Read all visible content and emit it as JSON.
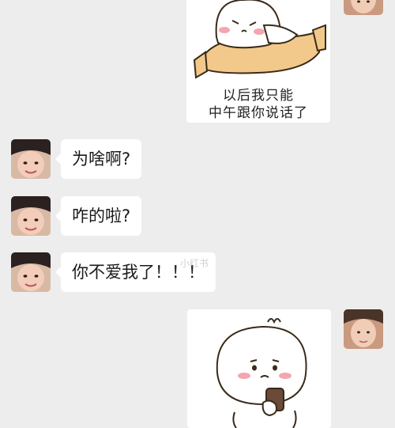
{
  "chat": {
    "messages": [
      {
        "sender": "me",
        "type": "sticker",
        "caption_line1": "以后我只能",
        "caption_line2": "中午跟你说话了"
      },
      {
        "sender": "other",
        "type": "text",
        "text": "为啥啊?"
      },
      {
        "sender": "other",
        "type": "text",
        "text": "咋的啦?"
      },
      {
        "sender": "other",
        "type": "text",
        "text": "你不爱我了！！！"
      },
      {
        "sender": "me",
        "type": "sticker",
        "caption_line1": "",
        "caption_line2": ""
      }
    ],
    "watermark": "小红书"
  },
  "colors": {
    "background": "#ededed",
    "bubble": "#ffffff",
    "text": "#1a1a1a"
  }
}
